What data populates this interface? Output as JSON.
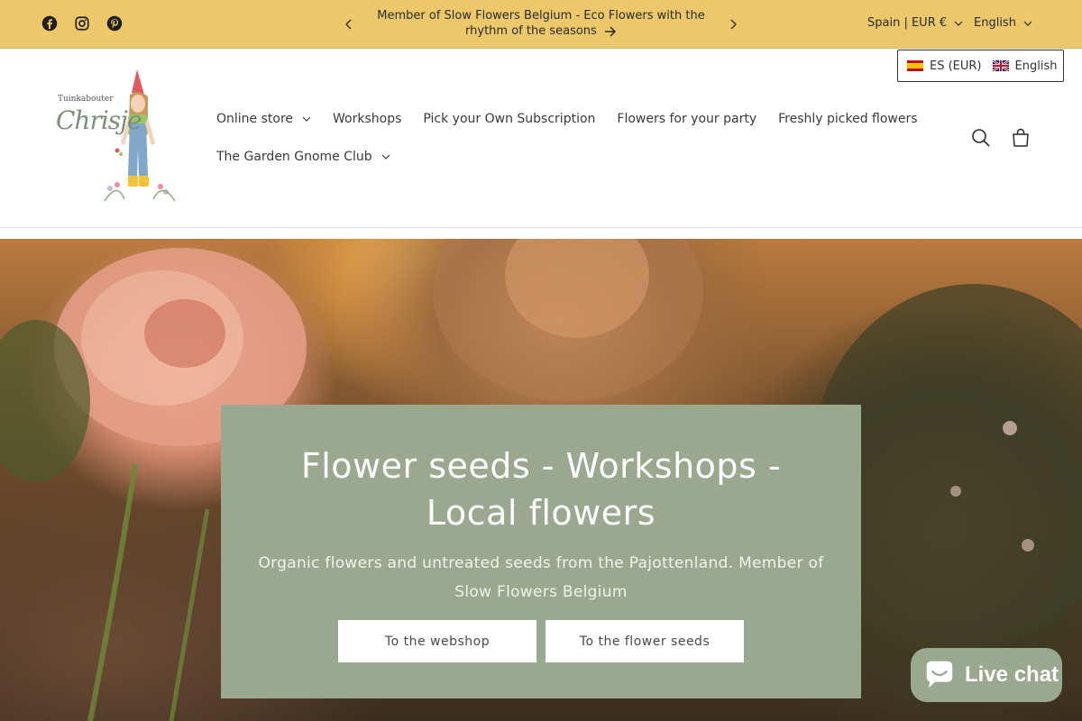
{
  "announcement": {
    "text": "Member of Slow Flowers Belgium - Eco Flowers with the rhythm of the seasons",
    "country_selector": "Spain | EUR €",
    "language_selector": "English"
  },
  "social": [
    "facebook-icon",
    "instagram-icon",
    "pinterest-icon"
  ],
  "logo": {
    "line1": "Tuinkabouter",
    "line2": "Chrisje"
  },
  "nav": {
    "row1": [
      {
        "label": "Online store",
        "dropdown": true
      },
      {
        "label": "Workshops",
        "dropdown": false
      },
      {
        "label": "Pick your Own Subscription",
        "dropdown": false
      },
      {
        "label": "Flowers for your party",
        "dropdown": false
      },
      {
        "label": "Freshly picked flowers",
        "dropdown": false
      }
    ],
    "row2": [
      {
        "label": "The Garden Gnome Club",
        "dropdown": true
      }
    ]
  },
  "lang_popup": {
    "currency": "ES (EUR)",
    "language": "English"
  },
  "hero": {
    "title": "Flower seeds - Workshops - Local flowers",
    "subtitle": "Organic flowers and untreated seeds from the Pajottenland. Member of Slow Flowers Belgium",
    "button1": "To the webshop",
    "button2": "To the flower seeds"
  },
  "chat": {
    "label": "Live chat"
  },
  "colors": {
    "announcement_bg": "#ecc86b",
    "sage": "#9aa88f"
  }
}
